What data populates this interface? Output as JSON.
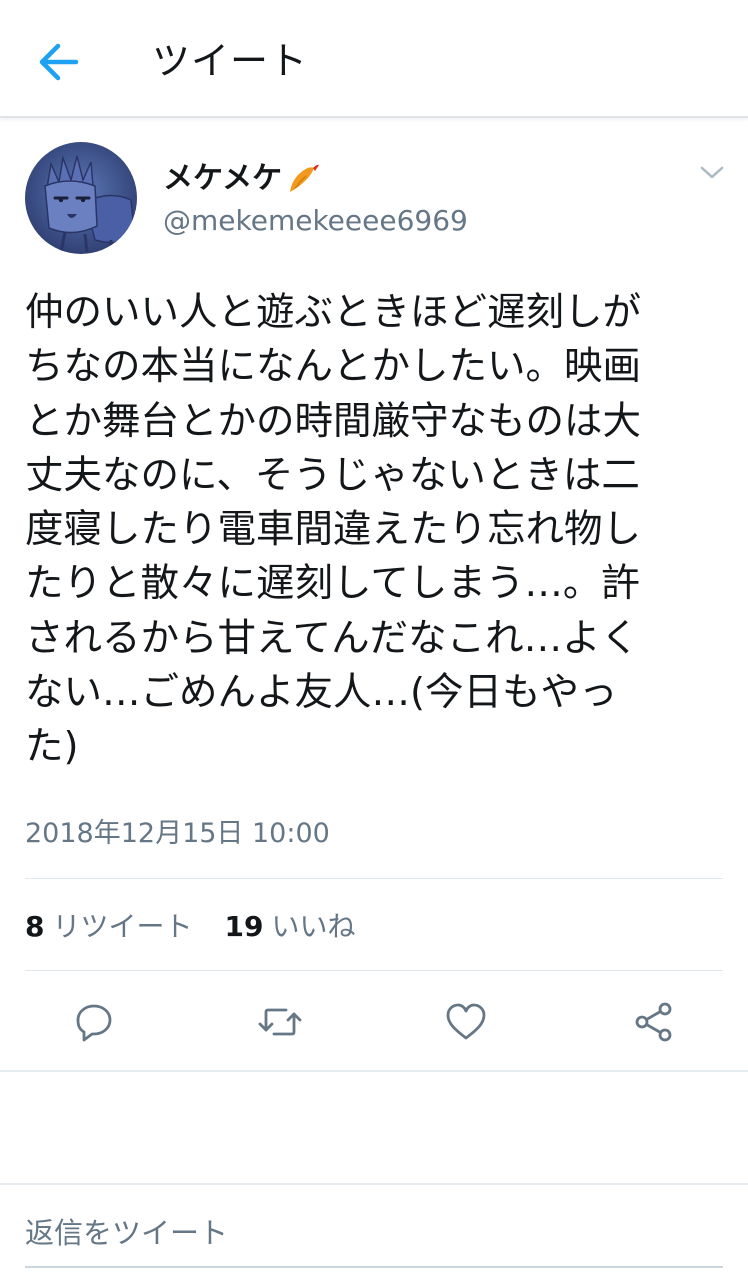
{
  "header": {
    "title": "ツイート",
    "back_icon": "arrow-left-icon"
  },
  "tweet": {
    "author": {
      "display_name": "メケメケ",
      "name_emoji": "fried-shrimp-emoji",
      "handle": "@mekemekeeee6969"
    },
    "text": "仲のいい人と遊ぶときほど遅刻しが\nちなの本当になんとかしたい。映画\nとか舞台とかの時間厳守なものは大\n丈夫なのに、そうじゃないときは二\n度寝したり電車間違えたり忘れ物し\nたりと散々に遅刻してしまう…。許\nされるから甘えてんだなこれ…よく\nない…ごめんよ友人…(今日もやっ\nた)",
    "timestamp": "2018年12月15日 10:00",
    "stats": {
      "retweet_count": "8",
      "retweet_label": "リツイート",
      "like_count": "19",
      "like_label": "いいね"
    },
    "actions": [
      "reply-icon",
      "retweet-icon",
      "like-heart-icon",
      "share-icon"
    ]
  },
  "reply": {
    "placeholder": "返信をツイート"
  },
  "colors": {
    "accent": "#1da1f2",
    "text_primary": "#14171a",
    "text_secondary": "#657786",
    "divider": "#e1e8ed"
  }
}
